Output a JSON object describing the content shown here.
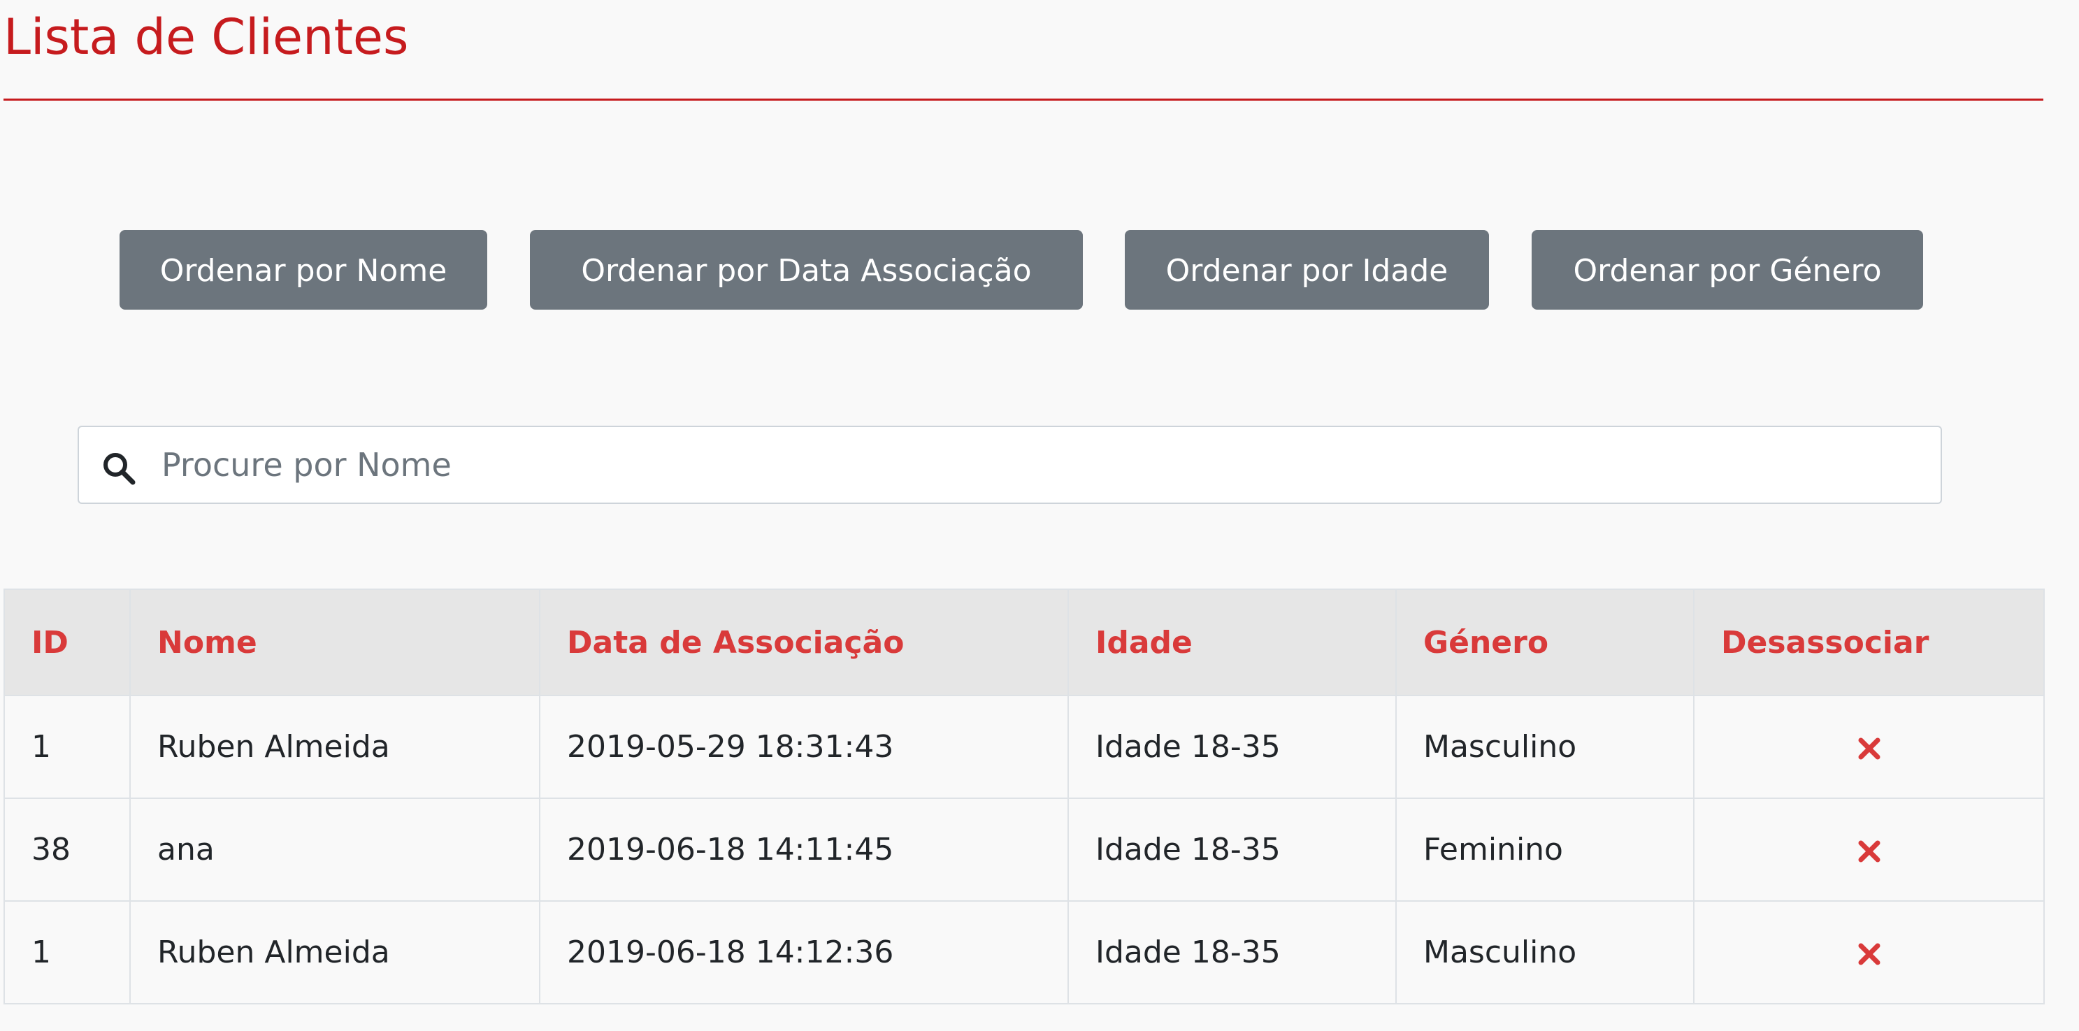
{
  "page": {
    "title": "Lista de Clientes"
  },
  "sort_buttons": [
    {
      "label": "Ordenar por Nome"
    },
    {
      "label": "Ordenar por Data Associação"
    },
    {
      "label": "Ordenar por Idade"
    },
    {
      "label": "Ordenar por Género"
    }
  ],
  "search": {
    "placeholder": "Procure por Nome",
    "value": "",
    "icon": "search-icon"
  },
  "table": {
    "columns": [
      "ID",
      "Nome",
      "Data de Associação",
      "Idade",
      "Género",
      "Desassociar"
    ],
    "rows": [
      {
        "id": "1",
        "nome": "Ruben Almeida",
        "data": "2019-05-29 18:31:43",
        "idade": "Idade 18-35",
        "genero": "Masculino",
        "action_icon": "remove-icon"
      },
      {
        "id": "38",
        "nome": "ana",
        "data": "2019-06-18 14:11:45",
        "idade": "Idade 18-35",
        "genero": "Feminino",
        "action_icon": "remove-icon"
      },
      {
        "id": "1",
        "nome": "Ruben Almeida",
        "data": "2019-06-18 14:12:36",
        "idade": "Idade 18-35",
        "genero": "Masculino",
        "action_icon": "remove-icon"
      }
    ]
  },
  "colors": {
    "title": "#c61b1e",
    "header_text": "#d93a3a",
    "button_bg": "#6c757d",
    "remove_icon": "#d93a3a"
  }
}
